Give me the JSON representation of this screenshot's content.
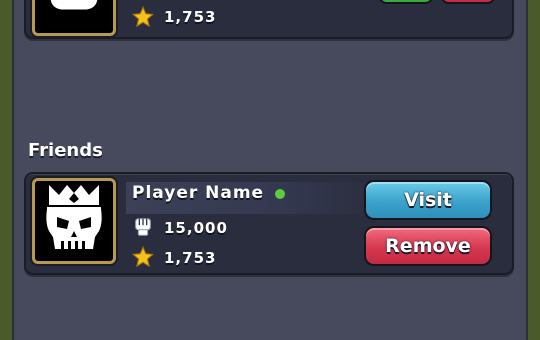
{
  "top_card": {
    "trophy_count": "1,753"
  },
  "friends_section": {
    "title": "Friends"
  },
  "friend": {
    "player_name": "Player Name",
    "online": true,
    "power_value": "15,000",
    "trophy_count": "1,753",
    "visit_label": "Visit",
    "remove_label": "Remove"
  },
  "colors": {
    "online": "#5ccc3a",
    "visit_button": "#3aa2cc",
    "remove_button": "#d6384f",
    "avatar_frame": "#b89a4e",
    "star": "#f5c21b"
  },
  "icons": {
    "power": "fist-icon",
    "trophy": "star-icon",
    "avatar": "crowned-skull-icon"
  }
}
